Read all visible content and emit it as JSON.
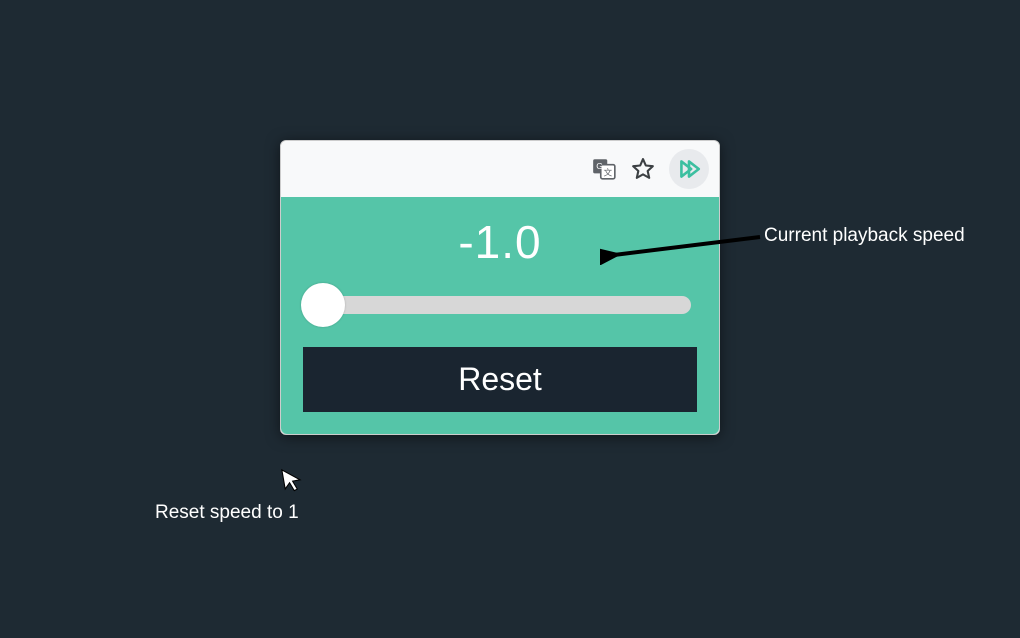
{
  "toolbar": {
    "icons": {
      "translate": "translate-icon",
      "star": "star-icon",
      "extension": "play-speed-icon"
    }
  },
  "panel": {
    "current_speed": "-1.0",
    "reset_label": "Reset"
  },
  "annotations": {
    "speed_label": "Current playback speed",
    "reset_label": "Reset speed to 1"
  },
  "colors": {
    "accent": "#55c5a8",
    "background": "#1e2a33",
    "button_bg": "#1a2530"
  }
}
